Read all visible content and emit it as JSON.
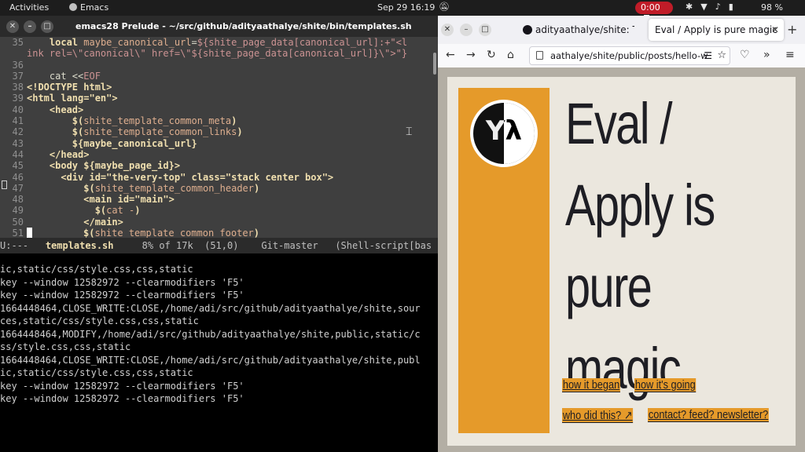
{
  "topbar": {
    "activities": "Activities",
    "app_name": "Emacs",
    "clock": "Sep 29  16:19",
    "recording_timer": "0:00",
    "battery": "98 %"
  },
  "emacs": {
    "title": "emacs28 Prelude - ~/src/github/adityaathalye/shite/bin/templates.sh",
    "modeline": {
      "status": "U:---",
      "buffer": "templates.sh",
      "position": "8% of 17k  (51,0)",
      "vc": "Git-master",
      "mode": "(Shell-script[bas"
    },
    "lines": [
      {
        "n": "35",
        "segs": [
          [
            "",
            "    "
          ],
          [
            "kw",
            "local"
          ],
          [
            "",
            " "
          ],
          [
            "var",
            "maybe_canonical_url"
          ],
          [
            "",
            "="
          ],
          [
            "str",
            "${shite_page_data[canonical_url]:+\"<l"
          ]
        ]
      },
      {
        "n": "",
        "segs": [
          [
            "str",
            "ink rel=\\\"canonical\\\" href=\\\"${shite_page_data[canonical_url]}\\\">\"}"
          ]
        ]
      },
      {
        "n": "36",
        "segs": []
      },
      {
        "n": "37",
        "segs": [
          [
            "",
            "    cat <<"
          ],
          [
            "str",
            "EOF"
          ]
        ]
      },
      {
        "n": "38",
        "segs": [
          [
            "kw",
            "<!DOCTYPE html>"
          ]
        ]
      },
      {
        "n": "39",
        "segs": [
          [
            "kw",
            "<html lang=\"en\">"
          ]
        ]
      },
      {
        "n": "40",
        "segs": [
          [
            "",
            "    "
          ],
          [
            "kw",
            "<head>"
          ]
        ]
      },
      {
        "n": "41",
        "segs": [
          [
            "",
            "        "
          ],
          [
            "kw",
            "$("
          ],
          [
            "var",
            "shite_template_common_meta"
          ],
          [
            "kw",
            ")"
          ]
        ]
      },
      {
        "n": "42",
        "segs": [
          [
            "",
            "        "
          ],
          [
            "kw",
            "$("
          ],
          [
            "var",
            "shite_template_common_links"
          ],
          [
            "kw",
            ")"
          ]
        ]
      },
      {
        "n": "43",
        "segs": [
          [
            "",
            "        "
          ],
          [
            "kw",
            "${maybe_canonical_url}"
          ]
        ]
      },
      {
        "n": "44",
        "segs": [
          [
            "",
            "    "
          ],
          [
            "kw",
            "</head>"
          ]
        ]
      },
      {
        "n": "45",
        "segs": [
          [
            "",
            "    "
          ],
          [
            "kw",
            "<body ${maybe_page_id}>"
          ]
        ]
      },
      {
        "n": "46",
        "segs": [
          [
            "",
            "      "
          ],
          [
            "kw",
            "<div id=\"the-very-top\" class=\"stack center box\">"
          ]
        ]
      },
      {
        "n": "47",
        "segs": [
          [
            "",
            "          "
          ],
          [
            "kw",
            "$("
          ],
          [
            "var",
            "shite_template_common_header"
          ],
          [
            "kw",
            ")"
          ]
        ]
      },
      {
        "n": "48",
        "segs": [
          [
            "",
            "          "
          ],
          [
            "kw",
            "<main id=\"main\">"
          ]
        ]
      },
      {
        "n": "49",
        "segs": [
          [
            "",
            "            "
          ],
          [
            "kw",
            "$("
          ],
          [
            "var",
            "cat -"
          ],
          [
            "kw",
            ")"
          ]
        ]
      },
      {
        "n": "50",
        "segs": [
          [
            "",
            "          "
          ],
          [
            "kw",
            "</main>"
          ]
        ]
      },
      {
        "n": "51",
        "segs": [
          [
            "cursor",
            ""
          ],
          [
            "",
            "         "
          ],
          [
            "kw",
            "$("
          ],
          [
            "var",
            "shite_template_common_footer"
          ],
          [
            "kw",
            ")"
          ]
        ]
      }
    ]
  },
  "terminal": {
    "lines": [
      "ic,static/css/style.css,css,static",
      "key --window 12582972 --clearmodifiers 'F5'",
      "key --window 12582972 --clearmodifiers 'F5'",
      "1664448464,CLOSE_WRITE:CLOSE,/home/adi/src/github/adityaathalye/shite,sour",
      "ces,static/css/style.css,css,static",
      "1664448464,MODIFY,/home/adi/src/github/adityaathalye/shite,public,static/c",
      "ss/style.css,css,static",
      "1664448464,CLOSE_WRITE:CLOSE,/home/adi/src/github/adityaathalye/shite,publ",
      "ic,static/css/style.css,css,static",
      "key --window 12582972 --clearmodifiers 'F5'",
      "key --window 12582972 --clearmodifiers 'F5'"
    ]
  },
  "firefox": {
    "tab_inactive": "adityaathalye/shite: The",
    "tab_active": "Eval / Apply is pure magic",
    "url": "aathalye/shite/public/posts/hello-w"
  },
  "page": {
    "logo_text": "Yλ",
    "title": "Eval / Apply is pure magic",
    "nav": {
      "how_it_began": "how it began",
      "how_its_going": "how it's going",
      "who_did_this": "who did this? ↗",
      "contact": "contact? feed? newsletter?"
    }
  }
}
